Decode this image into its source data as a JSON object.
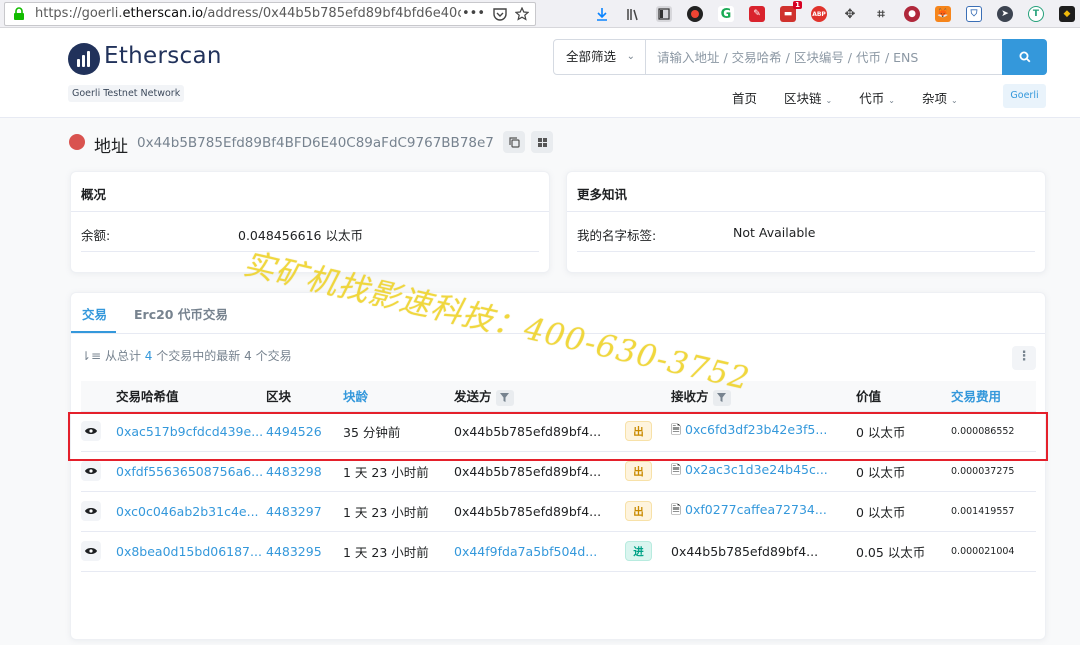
{
  "browser": {
    "url_prefix": "https://goerli.",
    "url_domain": "etherscan.io",
    "url_rest": "/address/0x44b5b785efd89bf4bfd6e40c89afc",
    "toolbar_badge": "1"
  },
  "header": {
    "logo_text": "Etherscan",
    "network": "Goerli Testnet Network",
    "search_filter": "全部筛选",
    "search_placeholder": "请输入地址 / 交易哈希 / 区块编号 / 代币 / ENS",
    "nav": [
      "首页",
      "区块链",
      "代币",
      "杂项"
    ],
    "network_pill": "Goerli"
  },
  "address": {
    "label": "地址",
    "value": "0x44b5B785Efd89Bf4BFD6E40C89aFdC9767BB78e7"
  },
  "overview": {
    "title": "概况",
    "balance_label": "余额:",
    "balance_value": "0.048456616 以太币"
  },
  "more_info": {
    "title": "更多知讯",
    "tag_label": "我的名字标签:",
    "tag_value": "Not Available"
  },
  "transactions": {
    "tabs": [
      "交易",
      "Erc20 代币交易"
    ],
    "summary_prefix": "从总计",
    "summary_total": "4",
    "summary_middle": "个交易中的最新",
    "summary_latest": "4",
    "summary_suffix": "个交易",
    "columns": {
      "hash": "交易哈希值",
      "block": "区块",
      "age": "块龄",
      "from": "发送方",
      "to": "接收方",
      "value": "价值",
      "fee": "交易费用"
    },
    "rows": [
      {
        "hash": "0xac517b9cfdcd439e...",
        "block": "4494526",
        "age": "35 分钟前",
        "from": "0x44b5b785efd89bf4...",
        "dir": "出",
        "to": "0xc6fd3df23b42e3f5...",
        "value": "0 以太币",
        "fee": "0.000086552"
      },
      {
        "hash": "0xfdf55636508756a6...",
        "block": "4483298",
        "age": "1 天 23 小时前",
        "from": "0x44b5b785efd89bf4...",
        "dir": "出",
        "to": "0x2ac3c1d3e24b45c...",
        "value": "0 以太币",
        "fee": "0.000037275"
      },
      {
        "hash": "0xc0c046ab2b31c4e...",
        "block": "4483297",
        "age": "1 天 23 小时前",
        "from": "0x44b5b785efd89bf4...",
        "dir": "出",
        "to": "0xf0277caffea72734...",
        "value": "0 以太币",
        "fee": "0.001419557"
      },
      {
        "hash": "0x8bea0d15bd06187...",
        "block": "4483295",
        "age": "1 天 23 小时前",
        "from": "0x44f9fda7a5bf504d...",
        "dir": "进",
        "to": "0x44b5b785efd89bf4...",
        "value": "0.05 以太币",
        "fee": "0.000021004"
      }
    ]
  },
  "watermark": "实矿机找影速科技：400-630-3752",
  "colors": {
    "accent": "#3498db",
    "brand": "#21325b",
    "highlight": "#e4202b",
    "watermark": "#f2d41e"
  }
}
